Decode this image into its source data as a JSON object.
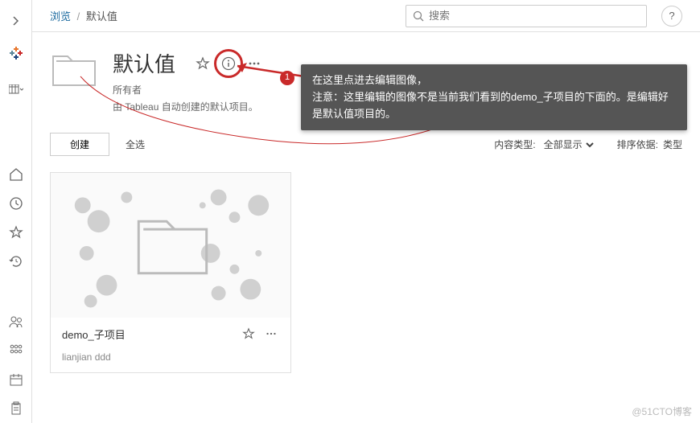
{
  "breadcrumb": {
    "root": "浏览",
    "current": "默认值"
  },
  "search": {
    "placeholder": "搜索"
  },
  "header": {
    "title": "默认值",
    "owner_label": "所有者",
    "description": "由 Tableau 自动创建的默认项目。"
  },
  "icons": {
    "star": "star-icon",
    "info": "info-icon",
    "more": "more-icon",
    "help": "help-icon",
    "search": "search-icon",
    "chevron": "chevron-right-icon",
    "folder": "folder-icon",
    "home": "home-icon",
    "clock": "clock-icon",
    "history": "history-icon",
    "users": "users-icon",
    "apps": "apps-icon",
    "calendar": "calendar-icon",
    "clipboard": "clipboard-icon",
    "grid_menu": "grid-dropdown-icon"
  },
  "toolbar": {
    "create": "创建",
    "select_all": "全选"
  },
  "filters": {
    "content_type_label": "内容类型:",
    "content_type_value": "全部显示",
    "sort_label": "排序依据:",
    "sort_value": "类型"
  },
  "card": {
    "title": "demo_子项目",
    "subtitle": "lianjian ddd"
  },
  "callout": {
    "badge": "1",
    "line1": "在这里点进去编辑图像，",
    "line2": "注意：这里编辑的图像不是当前我们看到的demo_子项目的下面的。是编辑好是默认值项目的。"
  },
  "watermark": "@51CTO博客",
  "colors": {
    "accent": "#c92a2a",
    "callout_bg": "#555555",
    "link": "#1a699e"
  }
}
